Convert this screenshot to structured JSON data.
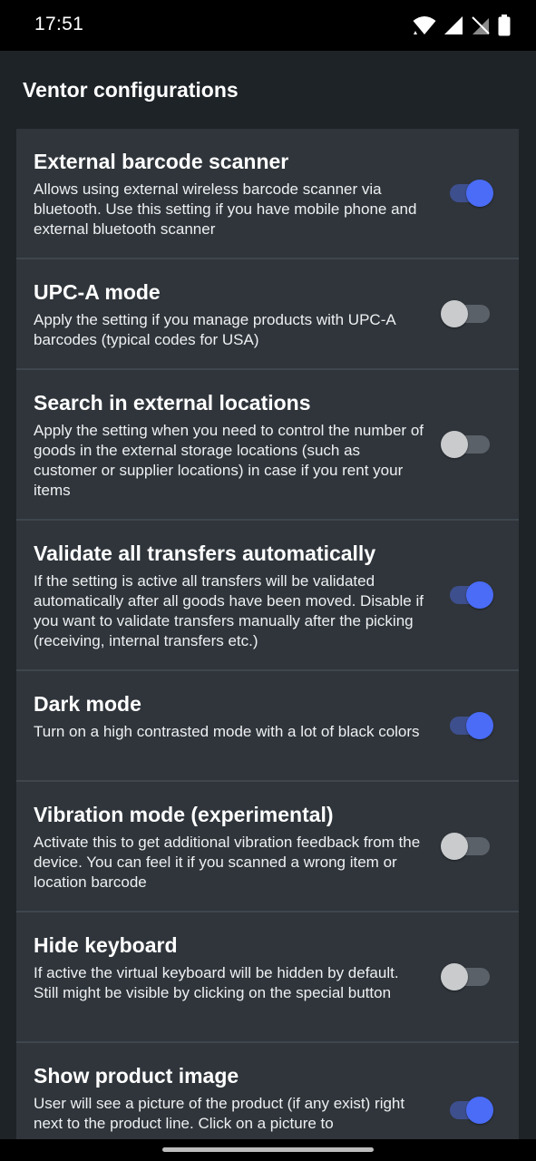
{
  "status_bar": {
    "time": "17:51",
    "icons": [
      "wifi-icon",
      "signal-icon",
      "no-sim-icon",
      "battery-icon"
    ]
  },
  "header": {
    "title": "Ventor configurations"
  },
  "colors": {
    "background": "#1e2328",
    "card": "#2f353b",
    "divider": "#3f464d",
    "switch_on_thumb": "#4a6cf7",
    "switch_on_track": "#3e4f8e",
    "switch_off_thumb": "#c9cbcd",
    "switch_off_track": "#5b6168"
  },
  "settings": [
    {
      "title": "External barcode scanner",
      "description": "Allows using external wireless barcode scanner via bluetooth. Use this setting if you have mobile phone and external bluetooth scanner",
      "enabled": true
    },
    {
      "title": "UPC-A mode",
      "description": "Apply the setting if you manage products with UPC-A barcodes (typical codes for USA)",
      "enabled": false
    },
    {
      "title": "Search in external locations",
      "description": "Apply the setting when you need to control the number of goods in the external storage locations (such as customer or supplier locations) in case if you rent your items",
      "enabled": false
    },
    {
      "title": "Validate all transfers automatically",
      "description": "If the setting is active all transfers will be validated automatically after all goods have been moved. Disable if you want to validate transfers manually after the picking (receiving, internal transfers etc.)",
      "enabled": true
    },
    {
      "title": "Dark mode",
      "description": "Turn on a high contrasted mode with a lot of black colors",
      "enabled": true
    },
    {
      "title": "Vibration mode (experimental)",
      "description": "Activate this to get additional vibration feedback from the device. You can feel it if you scanned a wrong item or location barcode",
      "enabled": false
    },
    {
      "title": "Hide keyboard",
      "description": "If active the virtual keyboard will be hidden by default. Still might be visible by clicking on the special button",
      "enabled": false
    },
    {
      "title": "Show product image",
      "description": "User will see a picture of the product (if any exist) right next to the product line. Click on a picture to",
      "enabled": true
    }
  ]
}
